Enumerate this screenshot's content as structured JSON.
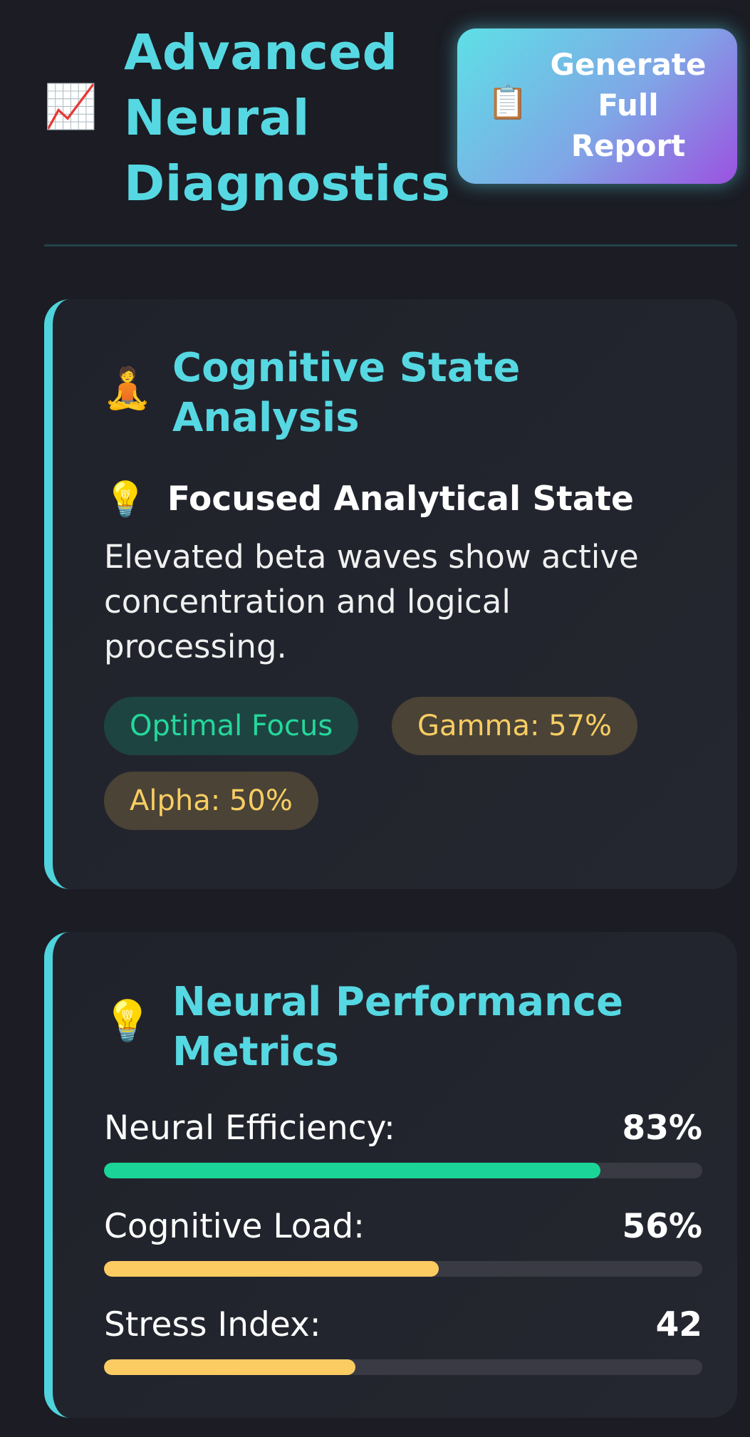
{
  "header": {
    "icon": "chart-increasing-icon",
    "title": "Advanced Neural Diagnostics",
    "report_button": {
      "icon": "clipboard-icon",
      "label": "Generate Full Report"
    }
  },
  "cognitive_card": {
    "icon": "meditation-icon",
    "title": "Cognitive State Analysis",
    "state": {
      "icon": "light-bulb-icon",
      "title": "Focused Analytical State",
      "description": "Elevated beta waves show active concentration and logical processing."
    },
    "badges": [
      {
        "label": "Optimal Focus",
        "color": "#25d89b"
      },
      {
        "label": "Gamma: 57%",
        "color": "#f8cd63"
      },
      {
        "label": "Alpha: 50%",
        "color": "#f8cd63"
      }
    ]
  },
  "metrics_card": {
    "icon": "light-bulb-icon",
    "title": "Neural Performance Metrics",
    "metrics": [
      {
        "label": "Neural Efficiency:",
        "value": "83%",
        "level": 0.83,
        "color": "#1ad597"
      },
      {
        "label": "Cognitive Load:",
        "value": "56%",
        "level": 0.56,
        "color": "#fccb62"
      },
      {
        "label": "Stress Index:",
        "value": "42",
        "level": 0.42,
        "color": "#fccb62"
      }
    ]
  },
  "colors": {
    "accent": "#56d8e2",
    "background": "#1b1c24",
    "card": "#22242d",
    "positive": "#1ad597",
    "warning": "#fccb62"
  }
}
